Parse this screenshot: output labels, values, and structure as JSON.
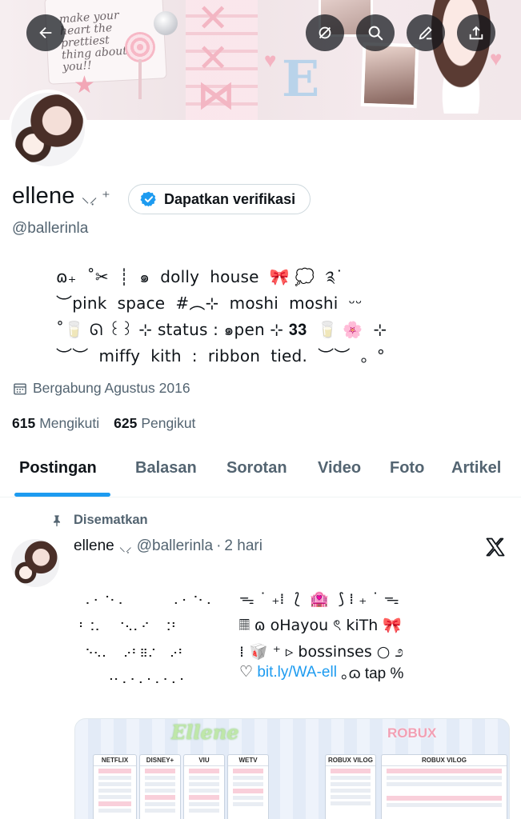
{
  "header": {
    "banner_text": "make your heart the prettiest thing about you!!",
    "buttons": {
      "back": "back-arrow-icon",
      "grok": "grok-icon",
      "search": "search-icon",
      "edit": "edit-icon",
      "share": "share-icon"
    }
  },
  "profile": {
    "display_name": "ellene",
    "name_emoji": "⸜⸝̣ ⁺",
    "verify_label": "Dapatkan verifikasi",
    "handle": "@ballerinla",
    "bio": "ɷ₊  ˚✂︎  ┊  ๑  dolly  house  🎀 💭  ༉˙\n︶pink  space  #︵⊹  moshi  moshi  ᵕᵕ\n˚🥛 ᘏ ꒰꒱ ⊹ status : ๑pen ⊹ 𝟑𝟑  🥛 🌸  ⊹\n︶︶  miffy  kith  :  ribbon  tied.  ︶︶  。°",
    "joined": "Bergabung Agustus 2016",
    "following_count": "615",
    "following_label": "Mengikuti",
    "followers_count": "625",
    "followers_label": "Pengikut"
  },
  "tabs": [
    {
      "label": "Postingan",
      "active": true
    },
    {
      "label": "Balasan"
    },
    {
      "label": "Sorotan"
    },
    {
      "label": "Video"
    },
    {
      "label": "Foto"
    },
    {
      "label": "Artikel"
    }
  ],
  "post": {
    "pinned_label": "Disematkan",
    "author": "ellene",
    "author_emoji": "⸜⸝̣",
    "handle": "@ballerinla",
    "dot": "·",
    "time": "2 hari",
    "braille_art": " ⠄⠂⠈⠂⠄       ⠄⠂⠈⠂⠄\n⠃⠨⠄  ⠈⠢⠄⠊  ⠨⠃\n ⠑⠢⠄  ⠔⠃⠿⠌  ⠔⠃\n    ⠐⠂⠄⠂⠄⠂⠄⠂⠄⠂",
    "text_lines": "ᯓ ˙ ₊⁞  ⟅  🏩  ⟆ ⁞ ₊ ˙ ᯓ\n𝄜 ɷ oHayou ৎ kiTh 🎀\n⁞ 🥡 ⁺ ▹ bossinses ○ ೨",
    "link_prefix": "♡",
    "link": "bit.ly/WA-ell",
    "link_suffix": " ｡ɷ tap %"
  },
  "media": {
    "title_left": "Ellene",
    "title_right": "ROBUX",
    "panels": [
      "NETFLIX",
      "DISNEY+",
      "VIU",
      "WETV",
      "ROBUX VILOG",
      "ROBUX VILOG"
    ]
  }
}
